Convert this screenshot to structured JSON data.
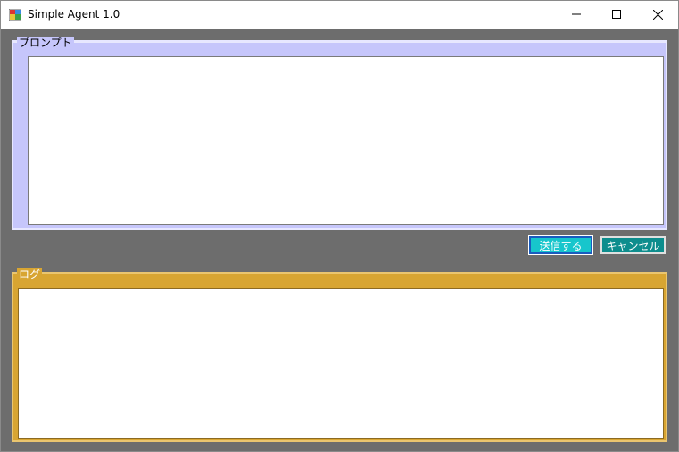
{
  "window": {
    "title": "Simple Agent 1.0",
    "controls": {
      "minimize": "─",
      "maximize": "☐",
      "close": "✕"
    }
  },
  "prompt": {
    "legend": "プロンプト",
    "value": ""
  },
  "buttons": {
    "send_label": "送信する",
    "cancel_label": "キャンセル"
  },
  "log": {
    "legend": "ログ",
    "value": ""
  },
  "colors": {
    "background": "#6d6d6d",
    "prompt_group": "#c6c6fb",
    "log_group": "#d8a532",
    "send_button": "#17c6cc",
    "cancel_button": "#0d8d8d"
  }
}
